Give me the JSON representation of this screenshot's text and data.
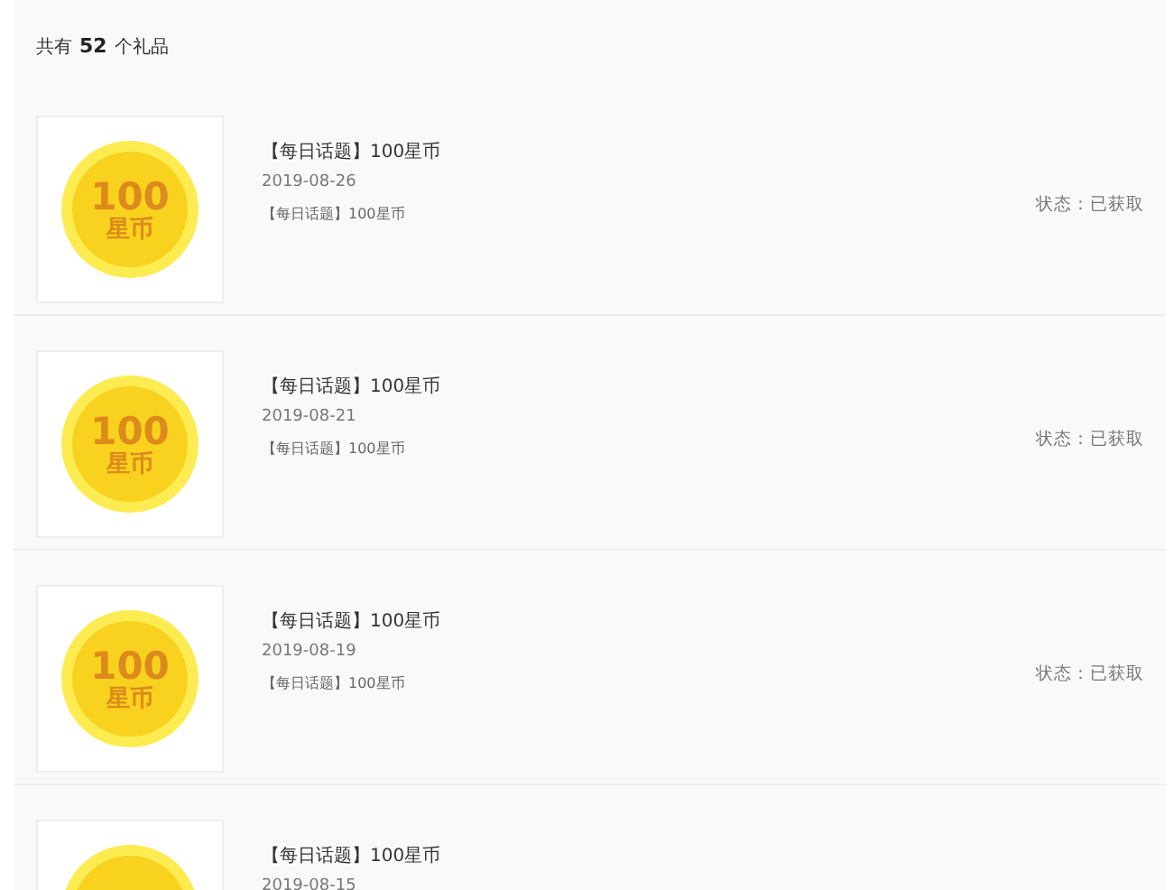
{
  "summary": {
    "prefix": "共有",
    "count": "52",
    "suffix": "个礼品"
  },
  "gifts": [
    {
      "coin_value": "100",
      "coin_unit": "星币",
      "title": "【每日话题】100星币",
      "date": "2019-08-26",
      "description": "【每日话题】100星币",
      "status": "状态：已获取"
    },
    {
      "coin_value": "100",
      "coin_unit": "星币",
      "title": "【每日话题】100星币",
      "date": "2019-08-21",
      "description": "【每日话题】100星币",
      "status": "状态：已获取"
    },
    {
      "coin_value": "100",
      "coin_unit": "星币",
      "title": "【每日话题】100星币",
      "date": "2019-08-19",
      "description": "【每日话题】100星币",
      "status": "状态：已获取"
    },
    {
      "title": "【每日话题】100星币",
      "date": "2019-08-15"
    }
  ]
}
